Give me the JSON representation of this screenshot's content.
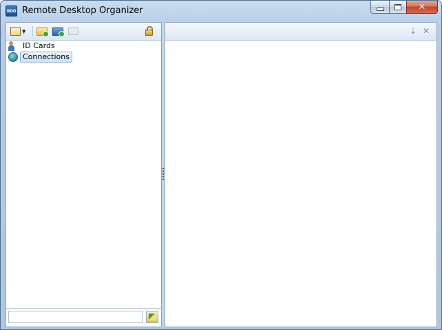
{
  "window": {
    "title": "Remote Desktop Organizer",
    "icon_text": "RDO",
    "caption_buttons": [
      "minimize-icon",
      "maximize-icon",
      "close-icon"
    ]
  },
  "left_toolbar": {
    "buttons": [
      "new-dropdown-icon",
      "add-folder-icon",
      "add-connection-icon",
      "id-card-icon",
      "lock-icon"
    ]
  },
  "tree": {
    "items": [
      {
        "label": "ID Cards",
        "icon": "people-icon",
        "selected": false
      },
      {
        "label": "Connections",
        "icon": "globe-icon",
        "selected": true
      }
    ]
  },
  "search": {
    "value": "",
    "placeholder": ""
  },
  "right_toolbar": {
    "pin_glyph": "⇣",
    "close_glyph": "✕"
  },
  "colors": {
    "window_frame": "#aec7e2",
    "selection": "#cde2f8",
    "close_button": "#c4442b"
  }
}
